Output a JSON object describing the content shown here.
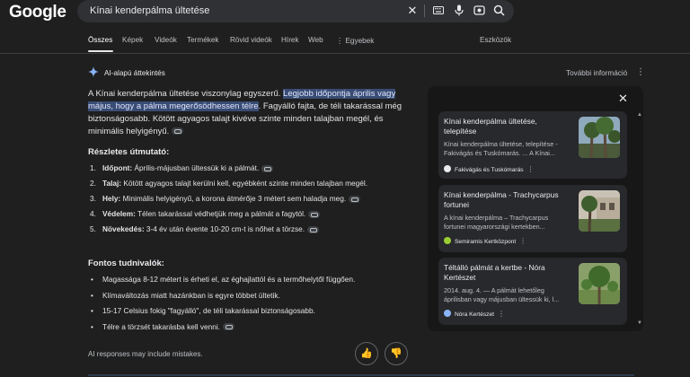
{
  "header": {
    "logo": "Google",
    "search_value": "Kínai kenderpálma ültetése"
  },
  "tabs": [
    {
      "label": "Összes",
      "active": true
    },
    {
      "label": "Képek"
    },
    {
      "label": "Videók"
    },
    {
      "label": "Termékek"
    },
    {
      "label": "Rövid videók"
    },
    {
      "label": "Hírek"
    },
    {
      "label": "Web"
    },
    {
      "label": "Egyebek"
    }
  ],
  "tools_label": "Eszközök",
  "ai_overview": {
    "heading": "AI-alapú áttekintés",
    "more_info": "További információ",
    "intro_start": "A Kínai kenderpálma ültetése viszonylag egyszerű. ",
    "intro_highlight": "Legjobb időpontja április vagy május, hogy a pálma megerősödhessen télre",
    "intro_end": ". Fagyálló fajta, de téli takarással még biztonságosabb. Kötött agyagos talajt kivéve szinte minden talajban megél, és minimális helyigényű.",
    "guide_heading": "Részletes útmutató:",
    "steps": [
      {
        "num": "1.",
        "bold": "Időpont:",
        "text": " Április-májusban ültessük ki a pálmát."
      },
      {
        "num": "2.",
        "bold": "Talaj:",
        "text": " Kötött agyagos talajt kerülni kell, egyébként szinte minden talajban megél."
      },
      {
        "num": "3.",
        "bold": "Hely:",
        "text": " Minimális helyigényű, a korona átmérője 3 métert sem haladja meg."
      },
      {
        "num": "4.",
        "bold": "Védelem:",
        "text": " Télen takarással védhetjük meg a pálmát a fagytól."
      },
      {
        "num": "5.",
        "bold": "Növekedés:",
        "text": " 3-4 év után évente 10-20 cm-t is nőhet a törzse."
      }
    ],
    "facts_heading": "Fontos tudnivalók:",
    "facts": [
      "Magassága 8-12 métert is érheti el, az éghajlattól és a termőhelytől függően.",
      "Klímaváltozás miatt hazánkban is egyre többet ültetik.",
      "15-17 Celsius fokig \"fagyálló\", de téli takarással biztonságosabb.",
      "Télre a törzsét takarásba kell venni."
    ],
    "disclaimer": "AI responses may include mistakes."
  },
  "sources": [
    {
      "title": "Kínai kenderpálma ültetése, telepítése",
      "desc": "Kínai kenderpálma ültetése, telepítése - Fakivágás és Tuskómarás. ... A Kínai...",
      "source": "Fakivágás és Tuskómarás",
      "favicon_color": "#e8eaed"
    },
    {
      "title": "Kínai kenderpálma - Trachycarpus fortunei",
      "desc": "A kínai kenderpálma – Trachycarpus fortunei magyarországi kertekben...",
      "source": "Semiramis Kertközpont",
      "favicon_color": "#9acd32"
    },
    {
      "title": "Téltálló pálmát a kertbe - Nóra Kertészet",
      "desc": "2014. aug. 4. — A pálmát lehetőleg áprilisban vagy májusban ültessük ki, l...",
      "source": "Nóra Kertészet",
      "favicon_color": "#8ab4f8"
    }
  ]
}
